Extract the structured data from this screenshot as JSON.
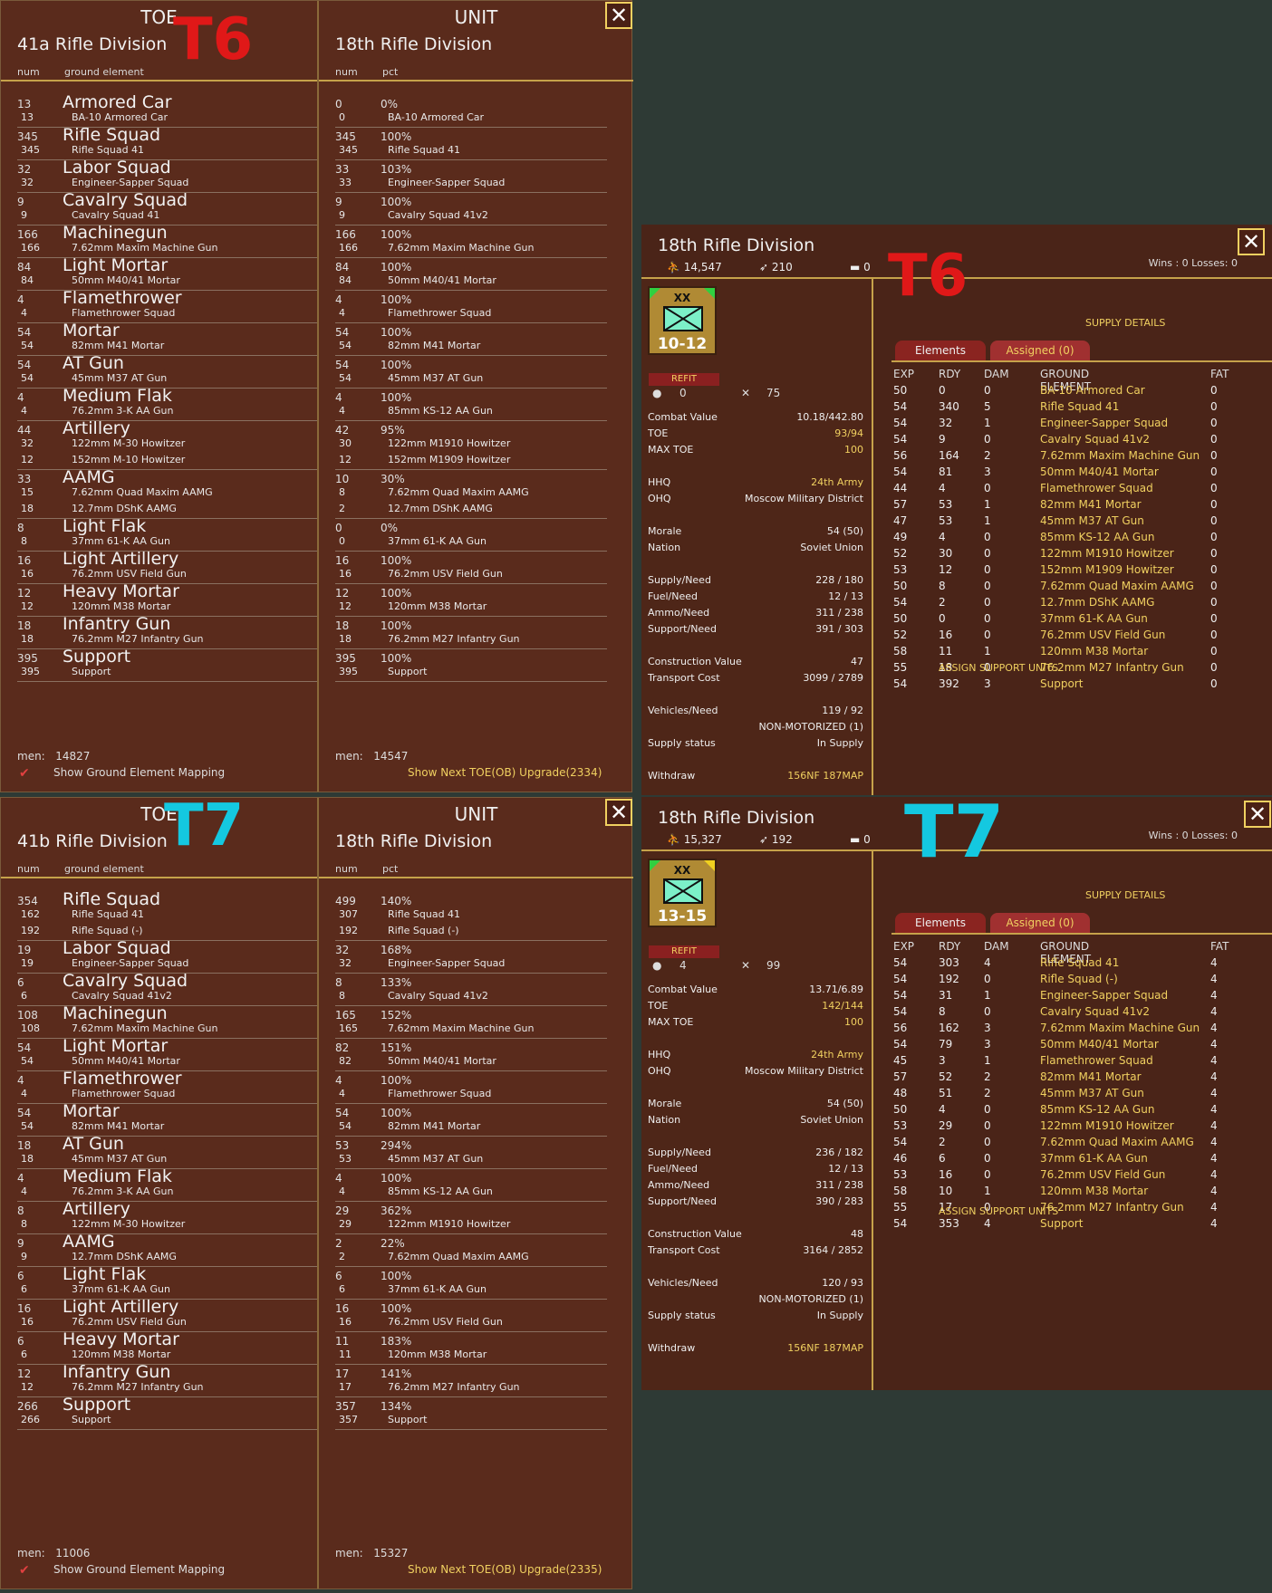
{
  "t6": {
    "left_header": "TOE",
    "left_division": "41a Rifle Division",
    "right_header": "UNIT",
    "right_division": "18th Rifle Division",
    "col_num": "num",
    "col_ground": "ground element",
    "col_pct": "pct",
    "rows": [
      {
        "n": "13",
        "name": "Armored Car",
        "subs": [
          [
            "13",
            "BA-10 Armored Car"
          ]
        ],
        "un": "0",
        "pct": "0%",
        "usubs": [
          [
            "0",
            "BA-10 Armored Car"
          ]
        ]
      },
      {
        "n": "345",
        "name": "Rifle Squad",
        "subs": [
          [
            "345",
            "Rifle Squad 41"
          ]
        ],
        "un": "345",
        "pct": "100%",
        "usubs": [
          [
            "345",
            "Rifle Squad 41"
          ]
        ]
      },
      {
        "n": "32",
        "name": "Labor Squad",
        "subs": [
          [
            "32",
            "Engineer-Sapper Squad"
          ]
        ],
        "un": "33",
        "pct": "103%",
        "usubs": [
          [
            "33",
            "Engineer-Sapper Squad"
          ]
        ]
      },
      {
        "n": "9",
        "name": "Cavalry Squad",
        "subs": [
          [
            "9",
            "Cavalry Squad 41"
          ]
        ],
        "un": "9",
        "pct": "100%",
        "usubs": [
          [
            "9",
            "Cavalry Squad 41v2"
          ]
        ]
      },
      {
        "n": "166",
        "name": "Machinegun",
        "subs": [
          [
            "166",
            "7.62mm Maxim Machine Gun"
          ]
        ],
        "un": "166",
        "pct": "100%",
        "usubs": [
          [
            "166",
            "7.62mm Maxim Machine Gun"
          ]
        ]
      },
      {
        "n": "84",
        "name": "Light Mortar",
        "subs": [
          [
            "84",
            "50mm M40/41 Mortar"
          ]
        ],
        "un": "84",
        "pct": "100%",
        "usubs": [
          [
            "84",
            "50mm M40/41 Mortar"
          ]
        ]
      },
      {
        "n": "4",
        "name": "Flamethrower",
        "subs": [
          [
            "4",
            "Flamethrower Squad"
          ]
        ],
        "un": "4",
        "pct": "100%",
        "usubs": [
          [
            "4",
            "Flamethrower Squad"
          ]
        ]
      },
      {
        "n": "54",
        "name": "Mortar",
        "subs": [
          [
            "54",
            "82mm M41 Mortar"
          ]
        ],
        "un": "54",
        "pct": "100%",
        "usubs": [
          [
            "54",
            "82mm M41 Mortar"
          ]
        ]
      },
      {
        "n": "54",
        "name": "AT Gun",
        "subs": [
          [
            "54",
            "45mm M37 AT Gun"
          ]
        ],
        "un": "54",
        "pct": "100%",
        "usubs": [
          [
            "54",
            "45mm M37 AT Gun"
          ]
        ]
      },
      {
        "n": "4",
        "name": "Medium Flak",
        "subs": [
          [
            "4",
            "76.2mm 3-K AA Gun"
          ]
        ],
        "un": "4",
        "pct": "100%",
        "usubs": [
          [
            "4",
            "85mm KS-12 AA Gun"
          ]
        ]
      },
      {
        "n": "44",
        "name": "Artillery",
        "subs": [
          [
            "32",
            "122mm M-30 Howitzer"
          ],
          [
            "12",
            "152mm M-10 Howitzer"
          ]
        ],
        "un": "42",
        "pct": "95%",
        "usubs": [
          [
            "30",
            "122mm M1910 Howitzer"
          ],
          [
            "12",
            "152mm M1909 Howitzer"
          ]
        ]
      },
      {
        "n": "33",
        "name": "AAMG",
        "subs": [
          [
            "15",
            "7.62mm Quad Maxim AAMG"
          ],
          [
            "18",
            "12.7mm DShK AAMG"
          ]
        ],
        "un": "10",
        "pct": "30%",
        "usubs": [
          [
            "8",
            "7.62mm Quad Maxim AAMG"
          ],
          [
            "2",
            "12.7mm DShK AAMG"
          ]
        ]
      },
      {
        "n": "8",
        "name": "Light Flak",
        "subs": [
          [
            "8",
            "37mm 61-K AA Gun"
          ]
        ],
        "un": "0",
        "pct": "0%",
        "usubs": [
          [
            "0",
            "37mm 61-K AA Gun"
          ]
        ]
      },
      {
        "n": "16",
        "name": "Light Artillery",
        "subs": [
          [
            "16",
            "76.2mm USV Field Gun"
          ]
        ],
        "un": "16",
        "pct": "100%",
        "usubs": [
          [
            "16",
            "76.2mm USV Field Gun"
          ]
        ]
      },
      {
        "n": "12",
        "name": "Heavy Mortar",
        "subs": [
          [
            "12",
            "120mm M38 Mortar"
          ]
        ],
        "un": "12",
        "pct": "100%",
        "usubs": [
          [
            "12",
            "120mm M38 Mortar"
          ]
        ]
      },
      {
        "n": "18",
        "name": "Infantry Gun",
        "subs": [
          [
            "18",
            "76.2mm M27 Infantry Gun"
          ]
        ],
        "un": "18",
        "pct": "100%",
        "usubs": [
          [
            "18",
            "76.2mm M27 Infantry Gun"
          ]
        ]
      },
      {
        "n": "395",
        "name": "Support",
        "subs": [
          [
            "395",
            "Support"
          ]
        ],
        "un": "395",
        "pct": "100%",
        "usubs": [
          [
            "395",
            "Support"
          ]
        ]
      }
    ],
    "men_label": "men:",
    "men_left": "14827",
    "men_right": "14547",
    "show_mapping": "Show Ground Element Mapping",
    "upgrade": "Show Next TOE(OB) Upgrade(2334)",
    "annotation": "T6"
  },
  "t7": {
    "left_header": "TOE",
    "left_division": "41b Rifle Division",
    "right_header": "UNIT",
    "right_division": "18th Rifle Division",
    "col_num": "num",
    "col_ground": "ground element",
    "col_pct": "pct",
    "rows": [
      {
        "n": "354",
        "name": "Rifle Squad",
        "subs": [
          [
            "162",
            "Rifle Squad 41"
          ],
          [
            "192",
            "Rifle Squad (-)"
          ]
        ],
        "un": "499",
        "pct": "140%",
        "usubs": [
          [
            "307",
            "Rifle Squad 41"
          ],
          [
            "192",
            "Rifle Squad (-)"
          ]
        ]
      },
      {
        "n": "19",
        "name": "Labor Squad",
        "subs": [
          [
            "19",
            "Engineer-Sapper Squad"
          ]
        ],
        "un": "32",
        "pct": "168%",
        "usubs": [
          [
            "32",
            "Engineer-Sapper Squad"
          ]
        ]
      },
      {
        "n": "6",
        "name": "Cavalry Squad",
        "subs": [
          [
            "6",
            "Cavalry Squad 41v2"
          ]
        ],
        "un": "8",
        "pct": "133%",
        "usubs": [
          [
            "8",
            "Cavalry Squad 41v2"
          ]
        ]
      },
      {
        "n": "108",
        "name": "Machinegun",
        "subs": [
          [
            "108",
            "7.62mm Maxim Machine Gun"
          ]
        ],
        "un": "165",
        "pct": "152%",
        "usubs": [
          [
            "165",
            "7.62mm Maxim Machine Gun"
          ]
        ]
      },
      {
        "n": "54",
        "name": "Light Mortar",
        "subs": [
          [
            "54",
            "50mm M40/41 Mortar"
          ]
        ],
        "un": "82",
        "pct": "151%",
        "usubs": [
          [
            "82",
            "50mm M40/41 Mortar"
          ]
        ]
      },
      {
        "n": "4",
        "name": "Flamethrower",
        "subs": [
          [
            "4",
            "Flamethrower Squad"
          ]
        ],
        "un": "4",
        "pct": "100%",
        "usubs": [
          [
            "4",
            "Flamethrower Squad"
          ]
        ]
      },
      {
        "n": "54",
        "name": "Mortar",
        "subs": [
          [
            "54",
            "82mm M41 Mortar"
          ]
        ],
        "un": "54",
        "pct": "100%",
        "usubs": [
          [
            "54",
            "82mm M41 Mortar"
          ]
        ]
      },
      {
        "n": "18",
        "name": "AT Gun",
        "subs": [
          [
            "18",
            "45mm M37 AT Gun"
          ]
        ],
        "un": "53",
        "pct": "294%",
        "usubs": [
          [
            "53",
            "45mm M37 AT Gun"
          ]
        ]
      },
      {
        "n": "4",
        "name": "Medium Flak",
        "subs": [
          [
            "4",
            "76.2mm 3-K AA Gun"
          ]
        ],
        "un": "4",
        "pct": "100%",
        "usubs": [
          [
            "4",
            "85mm KS-12 AA Gun"
          ]
        ]
      },
      {
        "n": "8",
        "name": "Artillery",
        "subs": [
          [
            "8",
            "122mm M-30 Howitzer"
          ]
        ],
        "un": "29",
        "pct": "362%",
        "usubs": [
          [
            "29",
            "122mm M1910 Howitzer"
          ]
        ]
      },
      {
        "n": "9",
        "name": "AAMG",
        "subs": [
          [
            "9",
            "12.7mm DShK AAMG"
          ]
        ],
        "un": "2",
        "pct": "22%",
        "usubs": [
          [
            "2",
            "7.62mm Quad Maxim AAMG"
          ]
        ]
      },
      {
        "n": "6",
        "name": "Light Flak",
        "subs": [
          [
            "6",
            "37mm 61-K AA Gun"
          ]
        ],
        "un": "6",
        "pct": "100%",
        "usubs": [
          [
            "6",
            "37mm 61-K AA Gun"
          ]
        ]
      },
      {
        "n": "16",
        "name": "Light Artillery",
        "subs": [
          [
            "16",
            "76.2mm USV Field Gun"
          ]
        ],
        "un": "16",
        "pct": "100%",
        "usubs": [
          [
            "16",
            "76.2mm USV Field Gun"
          ]
        ]
      },
      {
        "n": "6",
        "name": "Heavy Mortar",
        "subs": [
          [
            "6",
            "120mm M38 Mortar"
          ]
        ],
        "un": "11",
        "pct": "183%",
        "usubs": [
          [
            "11",
            "120mm M38 Mortar"
          ]
        ]
      },
      {
        "n": "12",
        "name": "Infantry Gun",
        "subs": [
          [
            "12",
            "76.2mm M27 Infantry Gun"
          ]
        ],
        "un": "17",
        "pct": "141%",
        "usubs": [
          [
            "17",
            "76.2mm M27 Infantry Gun"
          ]
        ]
      },
      {
        "n": "266",
        "name": "Support",
        "subs": [
          [
            "266",
            "Support"
          ]
        ],
        "un": "357",
        "pct": "134%",
        "usubs": [
          [
            "357",
            "Support"
          ]
        ]
      }
    ],
    "men_label": "men:",
    "men_left": "11006",
    "men_right": "15327",
    "show_mapping": "Show Ground Element Mapping",
    "upgrade": "Show Next TOE(OB) Upgrade(2335)",
    "annotation": "T7"
  },
  "d6": {
    "title": "18th Rifle Division",
    "men": "14,547",
    "guns": "210",
    "tanks": "0",
    "wins": "Wins : 0  Losses: 0",
    "counter": "10-12",
    "counter_xx": "XX",
    "refit": "REFIT",
    "icon_a": "0",
    "icon_b": "75",
    "kv": [
      [
        "Combat Value",
        "10.18/442.80"
      ],
      [
        "TOE",
        "93/94"
      ],
      [
        "MAX TOE",
        "100"
      ],
      [
        "",
        ""
      ],
      [
        "HHQ",
        "24th Army"
      ],
      [
        "OHQ",
        "Moscow Military District"
      ],
      [
        "",
        ""
      ],
      [
        "Morale",
        "54 (50)"
      ],
      [
        "Nation",
        "Soviet Union"
      ],
      [
        "",
        ""
      ],
      [
        "Supply/Need",
        "228 / 180"
      ],
      [
        "Fuel/Need",
        "12 / 13"
      ],
      [
        "Ammo/Need",
        "311 / 238"
      ],
      [
        "Support/Need",
        "391 / 303"
      ],
      [
        "",
        ""
      ],
      [
        "Construction Value",
        "47"
      ],
      [
        "Transport Cost",
        "3099 / 2789"
      ],
      [
        "",
        ""
      ],
      [
        "Vehicles/Need",
        "119 / 92"
      ],
      [
        "",
        "NON-MOTORIZED (1)"
      ],
      [
        "Supply status",
        "In Supply"
      ],
      [
        "",
        ""
      ],
      [
        "Withdraw",
        "156NF  187MAP"
      ]
    ],
    "supply_details": "SUPPLY DETAILS",
    "tab_elements": "Elements",
    "tab_assigned": "Assigned (0)",
    "headers": [
      "EXP",
      "RDY",
      "DAM",
      "GROUND ELEMENT",
      "FAT"
    ],
    "rows": [
      [
        "50",
        "0",
        "0",
        "BA-10 Armored Car",
        "0"
      ],
      [
        "54",
        "340",
        "5",
        "Rifle Squad 41",
        "0"
      ],
      [
        "54",
        "32",
        "1",
        "Engineer-Sapper Squad",
        "0"
      ],
      [
        "54",
        "9",
        "0",
        "Cavalry Squad 41v2",
        "0"
      ],
      [
        "56",
        "164",
        "2",
        "7.62mm Maxim Machine Gun",
        "0"
      ],
      [
        "54",
        "81",
        "3",
        "50mm M40/41 Mortar",
        "0"
      ],
      [
        "44",
        "4",
        "0",
        "Flamethrower Squad",
        "0"
      ],
      [
        "57",
        "53",
        "1",
        "82mm M41 Mortar",
        "0"
      ],
      [
        "47",
        "53",
        "1",
        "45mm M37 AT Gun",
        "0"
      ],
      [
        "49",
        "4",
        "0",
        "85mm KS-12 AA Gun",
        "0"
      ],
      [
        "52",
        "30",
        "0",
        "122mm M1910 Howitzer",
        "0"
      ],
      [
        "53",
        "12",
        "0",
        "152mm M1909 Howitzer",
        "0"
      ],
      [
        "50",
        "8",
        "0",
        "7.62mm Quad Maxim AAMG",
        "0"
      ],
      [
        "54",
        "2",
        "0",
        "12.7mm DShK AAMG",
        "0"
      ],
      [
        "50",
        "0",
        "0",
        "37mm 61-K AA Gun",
        "0"
      ],
      [
        "52",
        "16",
        "0",
        "76.2mm USV Field Gun",
        "0"
      ],
      [
        "58",
        "11",
        "1",
        "120mm M38 Mortar",
        "0"
      ],
      [
        "55",
        "18",
        "0",
        "76.2mm M27 Infantry Gun",
        "0"
      ],
      [
        "54",
        "392",
        "3",
        "Support",
        "0"
      ]
    ],
    "assign": "ASSIGN SUPPORT UNITS",
    "annotation": "T6"
  },
  "d7": {
    "title": "18th Rifle Division",
    "men": "15,327",
    "guns": "192",
    "tanks": "0",
    "wins": "Wins : 0  Losses: 0",
    "counter": "13-15",
    "counter_xx": "XX",
    "refit": "REFIT",
    "icon_a": "4",
    "icon_b": "99",
    "kv": [
      [
        "Combat Value",
        "13.71/6.89"
      ],
      [
        "TOE",
        "142/144"
      ],
      [
        "MAX TOE",
        "100"
      ],
      [
        "",
        ""
      ],
      [
        "HHQ",
        "24th Army"
      ],
      [
        "OHQ",
        "Moscow Military District"
      ],
      [
        "",
        ""
      ],
      [
        "Morale",
        "54 (50)"
      ],
      [
        "Nation",
        "Soviet Union"
      ],
      [
        "",
        ""
      ],
      [
        "Supply/Need",
        "236 / 182"
      ],
      [
        "Fuel/Need",
        "12 / 13"
      ],
      [
        "Ammo/Need",
        "311 / 238"
      ],
      [
        "Support/Need",
        "390 / 283"
      ],
      [
        "",
        ""
      ],
      [
        "Construction Value",
        "48"
      ],
      [
        "Transport Cost",
        "3164 / 2852"
      ],
      [
        "",
        ""
      ],
      [
        "Vehicles/Need",
        "120 / 93"
      ],
      [
        "",
        "NON-MOTORIZED (1)"
      ],
      [
        "Supply status",
        "In Supply"
      ],
      [
        "",
        ""
      ],
      [
        "Withdraw",
        "156NF  187MAP"
      ]
    ],
    "supply_details": "SUPPLY DETAILS",
    "tab_elements": "Elements",
    "tab_assigned": "Assigned (0)",
    "headers": [
      "EXP",
      "RDY",
      "DAM",
      "GROUND ELEMENT",
      "FAT"
    ],
    "rows": [
      [
        "54",
        "303",
        "4",
        "Rifle Squad 41",
        "4"
      ],
      [
        "54",
        "192",
        "0",
        "Rifle Squad (-)",
        "4"
      ],
      [
        "54",
        "31",
        "1",
        "Engineer-Sapper Squad",
        "4"
      ],
      [
        "54",
        "8",
        "0",
        "Cavalry Squad 41v2",
        "4"
      ],
      [
        "56",
        "162",
        "3",
        "7.62mm Maxim Machine Gun",
        "4"
      ],
      [
        "54",
        "79",
        "3",
        "50mm M40/41 Mortar",
        "4"
      ],
      [
        "45",
        "3",
        "1",
        "Flamethrower Squad",
        "4"
      ],
      [
        "57",
        "52",
        "2",
        "82mm M41 Mortar",
        "4"
      ],
      [
        "48",
        "51",
        "2",
        "45mm M37 AT Gun",
        "4"
      ],
      [
        "50",
        "4",
        "0",
        "85mm KS-12 AA Gun",
        "4"
      ],
      [
        "53",
        "29",
        "0",
        "122mm M1910 Howitzer",
        "4"
      ],
      [
        "54",
        "2",
        "0",
        "7.62mm Quad Maxim AAMG",
        "4"
      ],
      [
        "46",
        "6",
        "0",
        "37mm 61-K AA Gun",
        "4"
      ],
      [
        "53",
        "16",
        "0",
        "76.2mm USV Field Gun",
        "4"
      ],
      [
        "58",
        "10",
        "1",
        "120mm M38 Mortar",
        "4"
      ],
      [
        "55",
        "17",
        "0",
        "76.2mm M27 Infantry Gun",
        "4"
      ],
      [
        "54",
        "353",
        "4",
        "Support",
        "4"
      ]
    ],
    "assign": "ASSIGN SUPPORT UNITS",
    "annotation": "T7"
  }
}
